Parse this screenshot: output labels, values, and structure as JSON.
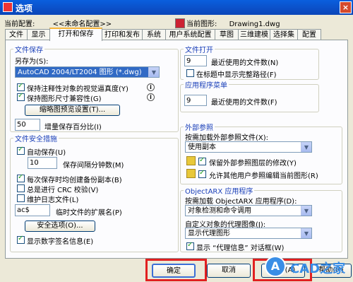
{
  "window": {
    "title": "选项",
    "close_glyph": "×"
  },
  "info": {
    "current_profile_label": "当前配置:",
    "current_profile_value": "<<未命名配置>>",
    "current_drawing_label": "当前图形:",
    "current_drawing_value": "Drawing1.dwg"
  },
  "tabs": [
    "文件",
    "显示",
    "打开和保存",
    "打印和发布",
    "系统",
    "用户系统配置",
    "草图",
    "三维建模",
    "选择集",
    "配置"
  ],
  "active_tab": "打开和保存",
  "file_save": {
    "group_label": "文件保存",
    "save_as_label": "另存为(S):",
    "save_as_value": "AutoCAD 2004/LT2004 图形 (*.dwg)",
    "keep_visual_fidelity_label": "保持注释性对象的视觉逼真度(Y)",
    "keep_drawing_size_label": "保持图形尺寸兼容性(G)",
    "thumbnail_button": "缩略图预览设置(T)...",
    "incremental_value": "50",
    "incremental_label": "增量保存百分比(I)"
  },
  "file_safety": {
    "group_label": "文件安全措施",
    "autosave_label": "自动保存(U)",
    "autosave_minutes": "10",
    "autosave_minutes_label": "保存间隔分钟数(M)",
    "backup_label": "每次保存时均创建备份副本(B)",
    "crc_label": "总是进行 CRC 校验(V)",
    "log_label": "维护日志文件(L)",
    "temp_ext_value": "ac$",
    "temp_ext_label": "临时文件的扩展名(P)",
    "security_button": "安全选项(O)...",
    "digital_sig_label": "显示数字签名信息(E)"
  },
  "file_open": {
    "group_label": "文件打开",
    "recent_value": "9",
    "recent_label": "最近使用的文件数(N)",
    "full_path_label": "在标题中显示完整路径(F)"
  },
  "app_menu": {
    "group_label": "应用程序菜单",
    "recent_value": "9",
    "recent_label": "最近使用的文件数(F)"
  },
  "xref": {
    "group_label": "外部参照",
    "demand_load_label": "按需加载外部参照文件(X):",
    "demand_load_value": "使用副本",
    "retain_changes_label": "保留外部参照图层的修改(Y)",
    "allow_edit_label": "允许其他用户参照编辑当前图形(R)"
  },
  "objectarx": {
    "group_label": "ObjectARX 应用程序",
    "demand_load_label": "按需加载 ObjectARX 应用程序(D):",
    "demand_load_value": "对象检测和命令调用",
    "proxy_label": "自定义对象的代理图像(J):",
    "proxy_value": "显示代理图形",
    "proxy_info_label": "显示 “代理信息” 对话框(W)"
  },
  "buttons": {
    "ok": "确定",
    "cancel": "取消",
    "apply": "应用(A)",
    "help": "帮助(H)"
  },
  "watermark": {
    "text": "CAD之家"
  },
  "colors": {
    "highlight_box": "#e12020",
    "title_bar": "#0b4fc7",
    "selection": "#316ac5"
  }
}
